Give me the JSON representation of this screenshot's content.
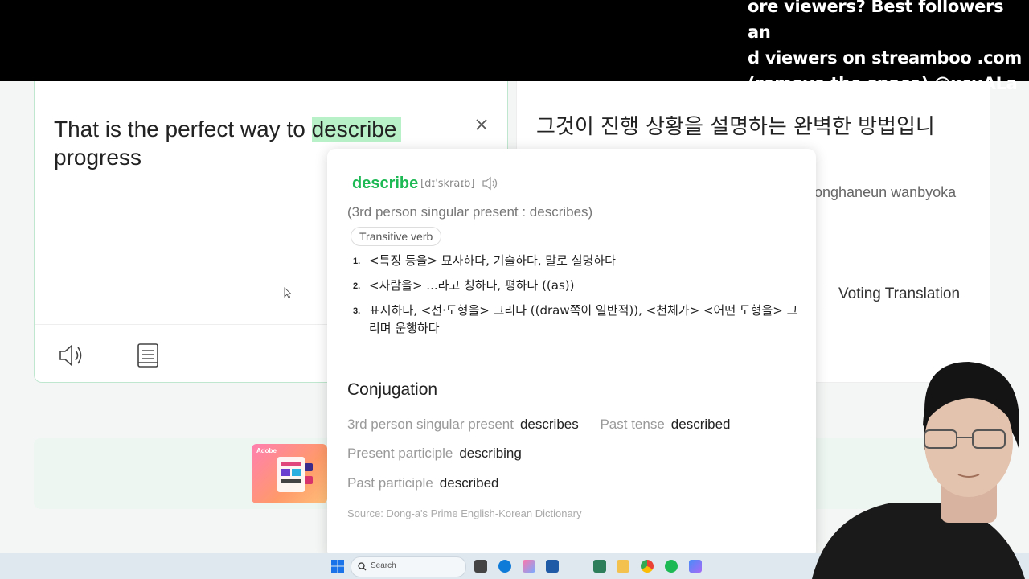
{
  "stream_overlay": {
    "text": "ore viewers? Best followers an\nd viewers on streamboo .com\n(remove the space) @xcuALa\nBi"
  },
  "source_panel": {
    "text_before": "That is the perfect way to ",
    "highlight": "describe",
    "text_after": " progress",
    "close_icon": "close-icon",
    "speaker_icon": "speaker-icon",
    "copy_icon": "document-icon"
  },
  "target_panel": {
    "text": "그것이 진행 상황을 설명하는 완벽한 방법입니",
    "romanization_partial": "onghaneun wanbyoka",
    "voting_label": "Voting Translation"
  },
  "dictionary": {
    "headword": "describe",
    "pronunciation": "[dɪˈskraɪb]",
    "inflection": "(3rd person singular present : describes)",
    "pos": "Transitive verb",
    "senses": [
      {
        "num": "1.",
        "text": "<특징 등을> 묘사하다, 기술하다, 말로 설명하다"
      },
      {
        "num": "2.",
        "text": "<사람을> ...라고 칭하다, 평하다 ((as))"
      },
      {
        "num": "3.",
        "text": "표시하다, <선·도형을> 그리다 ((draw쪽이 일반적)), <천체가> <어떤 도형을> 그리며 운행하다"
      }
    ],
    "conjugation_title": "Conjugation",
    "conjugation": {
      "third_label": "3rd person singular present",
      "third_value": "describes",
      "past_label": "Past tense",
      "past_value": "described",
      "pres_part_label": "Present participle",
      "pres_part_value": "describing",
      "past_part_label": "Past participle",
      "past_part_value": "described"
    },
    "source": "Source: Dong-a's Prime English-Korean Dictionary"
  },
  "ad": {
    "brand": "Adobe"
  },
  "taskbar": {
    "search_placeholder": "Search"
  },
  "colors": {
    "accent_green": "#1db954",
    "highlight": "#b8f0c8"
  }
}
